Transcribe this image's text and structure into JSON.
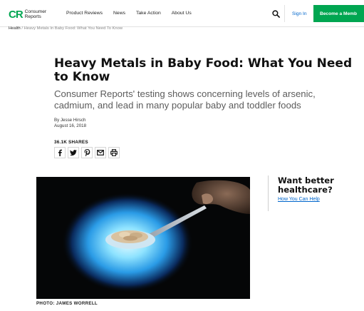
{
  "header": {
    "logo": {
      "mark": "CR",
      "line1": "Consumer",
      "line2": "Reports"
    },
    "nav": [
      "Product Reviews",
      "News",
      "Take Action",
      "About Us"
    ],
    "search_icon": "search-icon",
    "signin_label": "Sign In",
    "member_label": "Become a Memb",
    "accent_color": "#00a651"
  },
  "breadcrumb": {
    "section": "Health",
    "separator": " / ",
    "current": "Heavy Metals In Baby Food: What You Need To Know"
  },
  "article": {
    "title": "Heavy Metals in Baby Food: What You Need to Know",
    "dek": "Consumer Reports' testing shows concerning levels of arsenic, cadmium, and lead in many popular baby and toddler foods",
    "author": "By Jesse Hirsch",
    "date": "August 16, 2018",
    "shares": "36.1K SHARES",
    "share_icons": [
      "facebook-icon",
      "twitter-icon",
      "pinterest-icon",
      "email-icon",
      "print-icon"
    ],
    "photo_credit": "PHOTO: JAMES WORRELL"
  },
  "promo": {
    "title": "Want better healthcare?",
    "link": "How You Can Help"
  }
}
